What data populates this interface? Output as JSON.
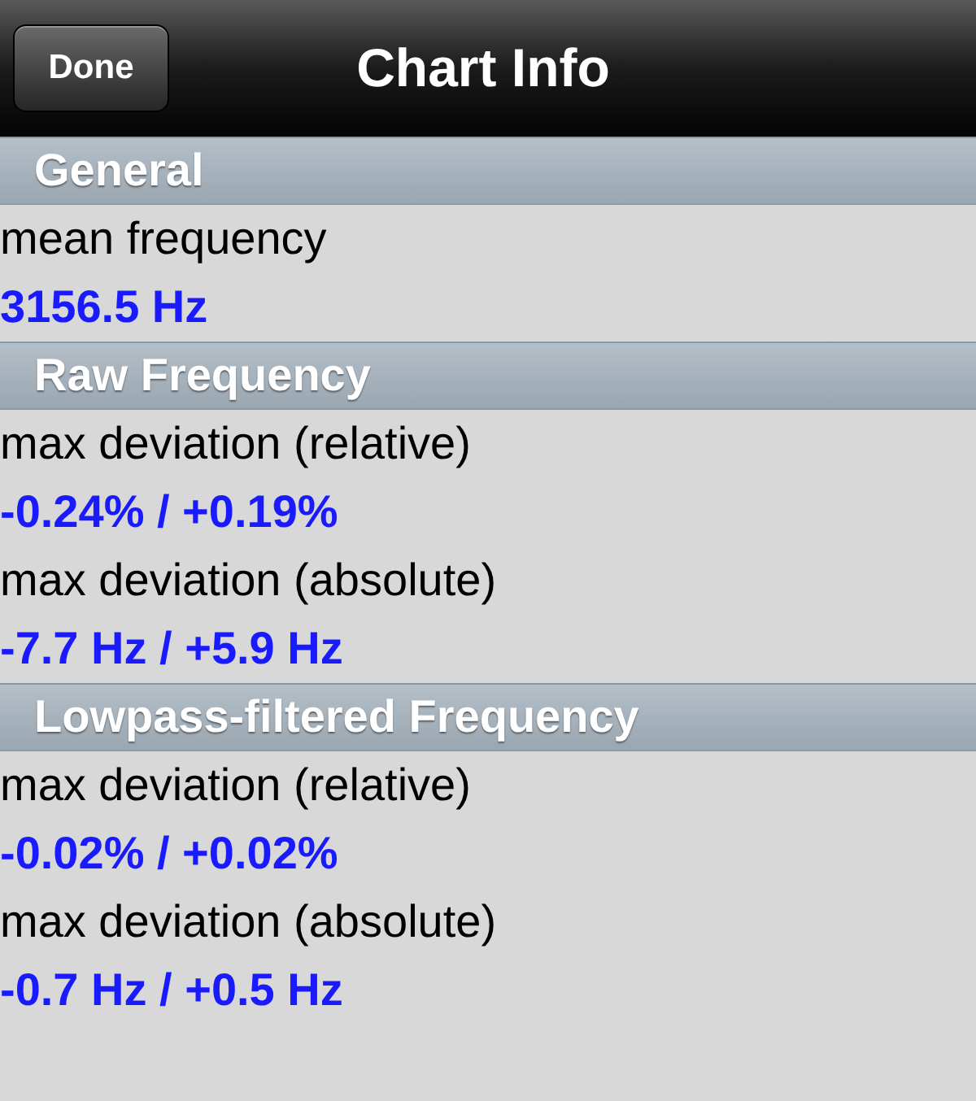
{
  "nav_bar": {
    "button": "Done",
    "title": "Chart Info"
  },
  "sections": [
    {
      "title": "General",
      "items": [
        {
          "label": "mean frequency",
          "value": "3156.5 Hz"
        }
      ]
    },
    {
      "title": "Raw Frequency",
      "items": [
        {
          "label": "max deviation (relative)",
          "value": "-0.24% / +0.19%"
        },
        {
          "label": "max deviation (absolute)",
          "value": "-7.7 Hz / +5.9 Hz"
        }
      ]
    },
    {
      "title": "Lowpass-filtered Frequency",
      "items": [
        {
          "label": "max deviation (relative)",
          "value": "-0.02% / +0.02%"
        },
        {
          "label": "max deviation (absolute)",
          "value": "-0.7 Hz / +0.5 Hz"
        }
      ]
    }
  ]
}
